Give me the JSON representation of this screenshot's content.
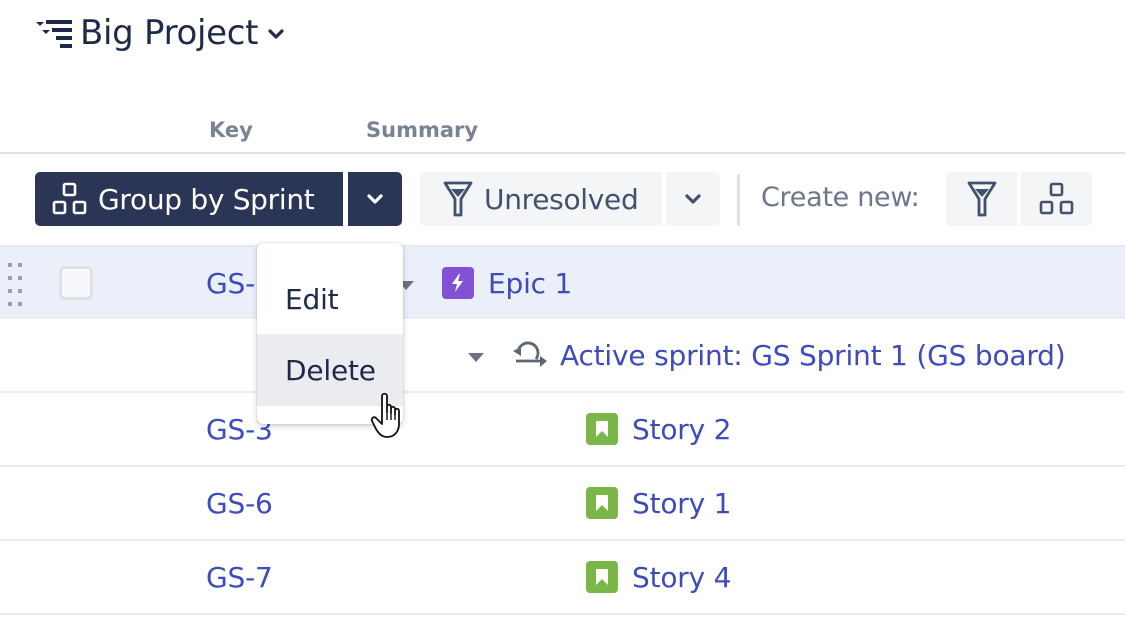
{
  "header": {
    "title": "Big Project",
    "title_icon": "structure-hierarchy-icon",
    "dropdown_icon": "chevron-down-icon"
  },
  "columns": [
    {
      "label": "Key"
    },
    {
      "label": "Summary"
    }
  ],
  "toolbar": {
    "group_by_label": "Group by Sprint",
    "group_by_icon": "group-icon",
    "group_by_dropdown_icon": "chevron-down-icon",
    "filter_label": "Unresolved",
    "filter_icon": "filter-icon",
    "filter_dropdown_icon": "chevron-down-icon",
    "create_new_label": "Create new:",
    "create_filter_icon": "filter-icon",
    "create_group_icon": "group-icon"
  },
  "colors": {
    "primary_button": "#2b3657",
    "link": "#3d4bbd",
    "epic": "#8252d6",
    "story": "#7ab648",
    "row_highlight": "#ebeffa"
  },
  "rows": [
    {
      "key": "GS-",
      "type": "epic",
      "type_icon": "epic-lightning-icon",
      "title": "Epic 1",
      "highlighted": true,
      "expanded": true
    },
    {
      "key": "",
      "type": "sprint",
      "type_icon": "sprint-cycle-icon",
      "title": "Active sprint: GS Sprint 1 (GS board)",
      "expanded": true
    },
    {
      "key": "GS-3",
      "type": "story",
      "type_icon": "story-bookmark-icon",
      "title": "Story 2"
    },
    {
      "key": "GS-6",
      "type": "story",
      "type_icon": "story-bookmark-icon",
      "title": "Story 1"
    },
    {
      "key": "GS-7",
      "type": "story",
      "type_icon": "story-bookmark-icon",
      "title": "Story 4"
    }
  ],
  "context_menu": {
    "items": [
      {
        "label": "Edit"
      },
      {
        "label": "Delete",
        "hovered": true
      }
    ]
  }
}
